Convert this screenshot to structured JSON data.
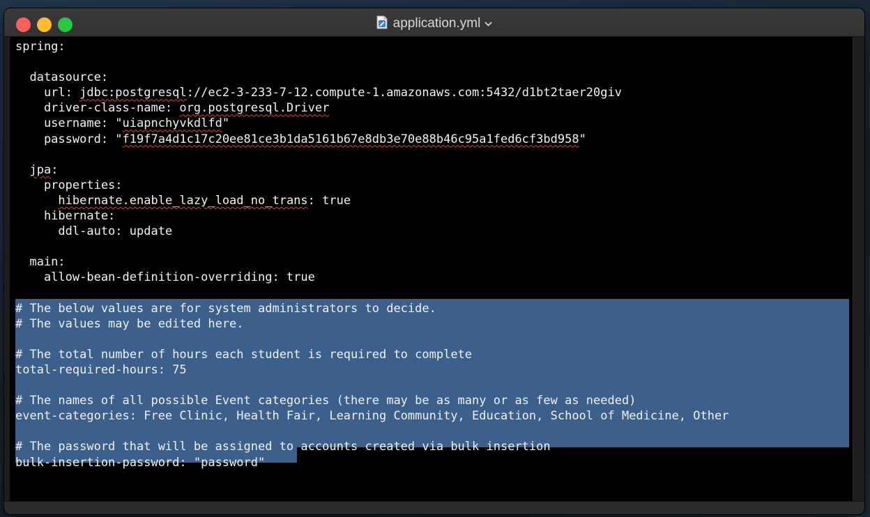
{
  "window": {
    "title": "application.yml",
    "icon": "document-icon",
    "controls": [
      "close",
      "minimize",
      "zoom"
    ]
  },
  "editor": {
    "lines": [
      [
        {
          "t": "spring:"
        }
      ],
      [
        {
          "t": ""
        }
      ],
      [
        {
          "t": "  datasource:"
        }
      ],
      [
        {
          "t": "    url: "
        },
        {
          "t": "jdbc:postgresql",
          "sq": true
        },
        {
          "t": "://ec2-3-233-7-12.compute-1.amazonaws.com:5432/d1bt2taer20giv"
        }
      ],
      [
        {
          "t": "    driver-class-name: "
        },
        {
          "t": "org.postgresql.Driver",
          "sq": true
        }
      ],
      [
        {
          "t": "    username: \""
        },
        {
          "t": "uiapnchyvkdlfd",
          "sq": true
        },
        {
          "t": "\""
        }
      ],
      [
        {
          "t": "    password: \""
        },
        {
          "t": "f19f7a4d1c17c20ee81ce3b1da5161b67e8db3e70e88b46c95a1fed6cf3bd958",
          "sq": true
        },
        {
          "t": "\""
        }
      ],
      [
        {
          "t": ""
        }
      ],
      [
        {
          "t": "  "
        },
        {
          "t": "jpa",
          "sq": true
        },
        {
          "t": ":"
        }
      ],
      [
        {
          "t": "    properties:"
        }
      ],
      [
        {
          "t": "      "
        },
        {
          "t": "hibernate.enable_lazy_load_no_trans",
          "sq": true
        },
        {
          "t": ": true"
        }
      ],
      [
        {
          "t": "    hibernate:"
        }
      ],
      [
        {
          "t": "      ddl-auto: update"
        }
      ],
      [
        {
          "t": ""
        }
      ],
      [
        {
          "t": "  main:"
        }
      ],
      [
        {
          "t": "    allow-bean-definition-overriding: true"
        }
      ],
      [
        {
          "t": ""
        }
      ],
      [
        {
          "t": "# The below values are for system administrators to decide."
        }
      ],
      [
        {
          "t": "# The values may be edited here."
        }
      ],
      [
        {
          "t": ""
        }
      ],
      [
        {
          "t": "# The total number of hours each student is required to complete"
        }
      ],
      [
        {
          "t": "total-required-hours: 75"
        }
      ],
      [
        {
          "t": ""
        }
      ],
      [
        {
          "t": "# The names of all possible Event categories (there may be as many or as few as needed)"
        }
      ],
      [
        {
          "t": "event-categories: Free Clinic, Health Fair, Learning Community, Education, School of Medicine, Other"
        }
      ],
      [
        {
          "t": ""
        }
      ],
      [
        {
          "t": "# The password that will be assigned to accounts created via bulk insertion"
        }
      ],
      [
        {
          "t": "bulk-insertion-password: \"password\""
        }
      ]
    ],
    "selection": {
      "from_line": 18,
      "to_line": 28
    },
    "colors": {
      "background": "#000000",
      "text": "#f2f2f2",
      "selection": "#3c5f8c",
      "spelling": "#e0473a"
    }
  }
}
